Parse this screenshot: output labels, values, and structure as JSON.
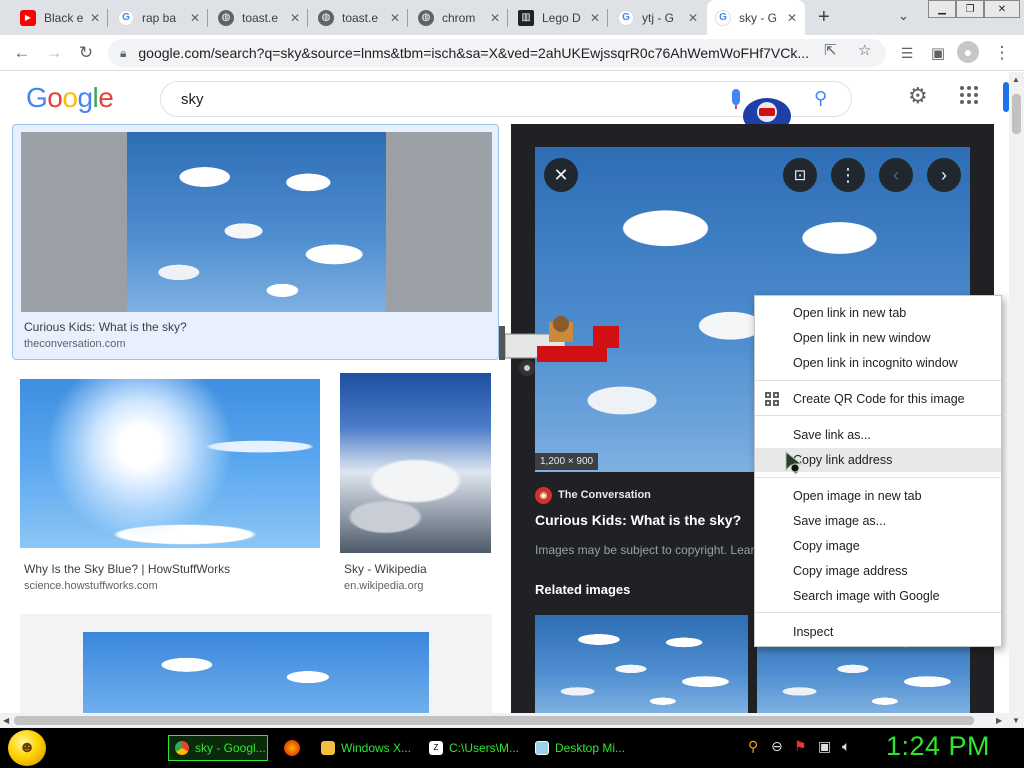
{
  "browser": {
    "tabs": [
      {
        "title": "Black e",
        "favicon": "youtube-icon"
      },
      {
        "title": "rap ba",
        "favicon": "google-icon"
      },
      {
        "title": "toast.e",
        "favicon": "globe-icon"
      },
      {
        "title": "toast.e",
        "favicon": "globe-icon"
      },
      {
        "title": "chrom",
        "favicon": "globe-icon"
      },
      {
        "title": "Lego D",
        "favicon": "museum-icon"
      },
      {
        "title": "ytj - G",
        "favicon": "google-icon"
      },
      {
        "title": "sky - G",
        "favicon": "google-icon",
        "active": true
      }
    ],
    "url": "google.com/search?q=sky&source=lnms&tbm=isch&sa=X&ved=2ahUKEwjssqrR0c76AhWemWoFHf7VCk..."
  },
  "google": {
    "logo_letters": [
      "G",
      "o",
      "o",
      "g",
      "l",
      "e"
    ],
    "query": "sky"
  },
  "results": [
    {
      "caption": "Curious Kids: What is the sky?",
      "source": "theconversation.com"
    },
    {
      "caption": "Why Is the Sky Blue? | HowStuffWorks",
      "source": "science.howstuffworks.com"
    },
    {
      "caption": "Sky - Wikipedia",
      "source": "en.wikipedia.org"
    }
  ],
  "preview": {
    "dimensions": "1,200 × 900",
    "source_name": "The Conversation",
    "title": "Curious Kids: What is the sky?",
    "copyright": "Images may be subject to copyright. Learn More",
    "related_heading": "Related images"
  },
  "context_menu": {
    "items": [
      "Open link in new tab",
      "Open link in new window",
      "Open link in incognito window",
      "Create QR Code for this image",
      "Save link as...",
      "Copy link address",
      "Open image in new tab",
      "Save image as...",
      "Copy image",
      "Copy image address",
      "Search image with Google",
      "Inspect"
    ],
    "hovered": "Copy link address"
  },
  "taskbar": {
    "tasks": [
      {
        "label": "sky - Googl...",
        "active": true
      },
      {
        "label": "Windows X..."
      },
      {
        "label": "C:\\Users\\M..."
      },
      {
        "label": "Desktop Mi..."
      }
    ],
    "clock": "1:24 PM"
  },
  "colors": {
    "accent": "#1a73e8",
    "panel_bg": "#202124",
    "taskbar_text": "#2ee62e"
  }
}
